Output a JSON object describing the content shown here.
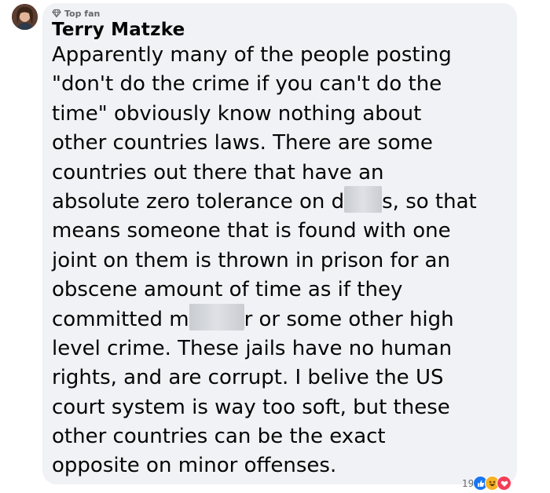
{
  "comment": {
    "badge": "Top fan",
    "author": "Terry Matzke",
    "lines": [
      [
        "Apparently many of the people posting"
      ],
      [
        "\"don't do the crime if you can't do the"
      ],
      [
        "time\" obviously know nothing about"
      ],
      [
        "other countries laws. There are some"
      ],
      [
        "countries out there that have an"
      ],
      [
        "absolute zero tolerance on d",
        "s, so that"
      ],
      [
        "means someone that is found with one"
      ],
      [
        "joint on them is thrown in prison for an"
      ],
      [
        "obscene amount of time as if they"
      ],
      [
        "committed m",
        "r or some other high"
      ],
      [
        "level crime. These jails have no human"
      ],
      [
        "rights, and are corrupt. I belive the US"
      ],
      [
        "court system is way too soft, but these"
      ],
      [
        "other countries can be the exact"
      ],
      [
        "opposite on minor offenses."
      ]
    ],
    "reaction_count": "19",
    "reaction_icons": [
      "like-icon",
      "haha-icon",
      "love-icon"
    ]
  },
  "colors": {
    "bubble": "#f0f2f5",
    "text": "#050505",
    "secondary": "#65676b",
    "like": "#1877f2",
    "haha": "#f7b125",
    "love": "#f33e58"
  }
}
